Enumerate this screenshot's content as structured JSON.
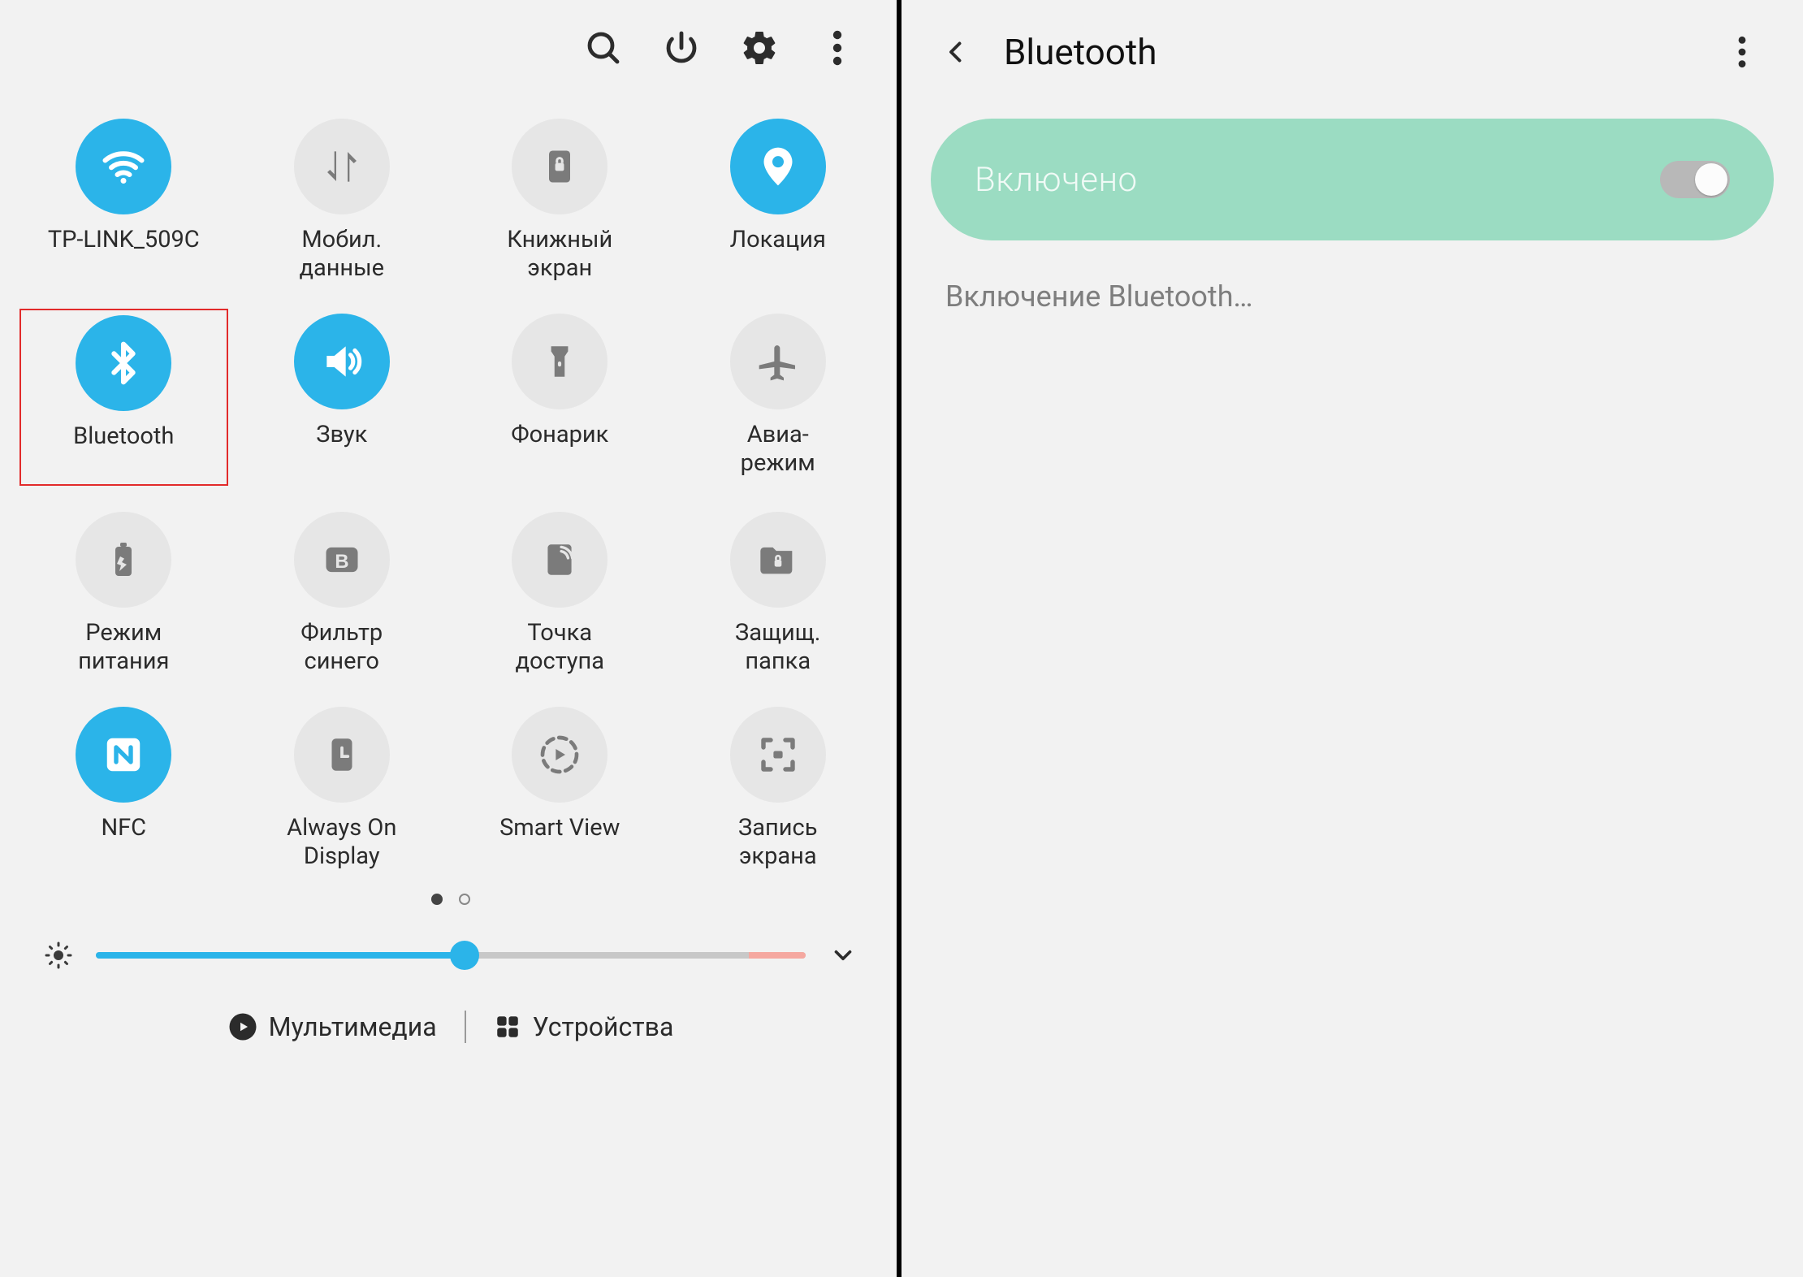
{
  "left": {
    "header_icons": [
      "search-icon",
      "power-icon",
      "gear-icon",
      "more-icon"
    ],
    "tiles": [
      {
        "id": "wifi",
        "label": "TP-LINK_509C",
        "active": true,
        "highlight": false
      },
      {
        "id": "mobiledata",
        "label": "Мобил.\nданные",
        "active": false,
        "highlight": false
      },
      {
        "id": "booklock",
        "label": "Книжный\nэкран",
        "active": false,
        "highlight": false
      },
      {
        "id": "location",
        "label": "Локация",
        "active": true,
        "highlight": false
      },
      {
        "id": "bluetooth",
        "label": "Bluetooth",
        "active": true,
        "highlight": true
      },
      {
        "id": "sound",
        "label": "Звук",
        "active": true,
        "highlight": false
      },
      {
        "id": "flashlight",
        "label": "Фонарик",
        "active": false,
        "highlight": false
      },
      {
        "id": "airplane",
        "label": "Авиа-\nрежим",
        "active": false,
        "highlight": false
      },
      {
        "id": "battery",
        "label": "Режим\nпитания",
        "active": false,
        "highlight": false
      },
      {
        "id": "bluefilter",
        "label": "Фильтр\nсинего",
        "active": false,
        "highlight": false
      },
      {
        "id": "hotspot",
        "label": "Точка\nдоступа",
        "active": false,
        "highlight": false
      },
      {
        "id": "secfolder",
        "label": "Защищ.\nпапка",
        "active": false,
        "highlight": false
      },
      {
        "id": "nfc",
        "label": "NFC",
        "active": true,
        "highlight": false
      },
      {
        "id": "aod",
        "label": "Always On\nDisplay",
        "active": false,
        "highlight": false
      },
      {
        "id": "smartview",
        "label": "Smart View",
        "active": false,
        "highlight": false
      },
      {
        "id": "screenrec",
        "label": "Запись\nэкрана",
        "active": false,
        "highlight": false
      }
    ],
    "page_index": 0,
    "page_count": 2,
    "brightness_percent": 52,
    "bottom": {
      "media": "Мультимедиа",
      "devices": "Устройства"
    }
  },
  "right": {
    "title": "Bluetooth",
    "pill_label": "Включено",
    "toggle_on": true,
    "status_text": "Включение Bluetooth…"
  },
  "colors": {
    "accent": "#2bb4e9",
    "pill_bg": "#9bdcc2",
    "highlight_border": "#e22b2b"
  }
}
